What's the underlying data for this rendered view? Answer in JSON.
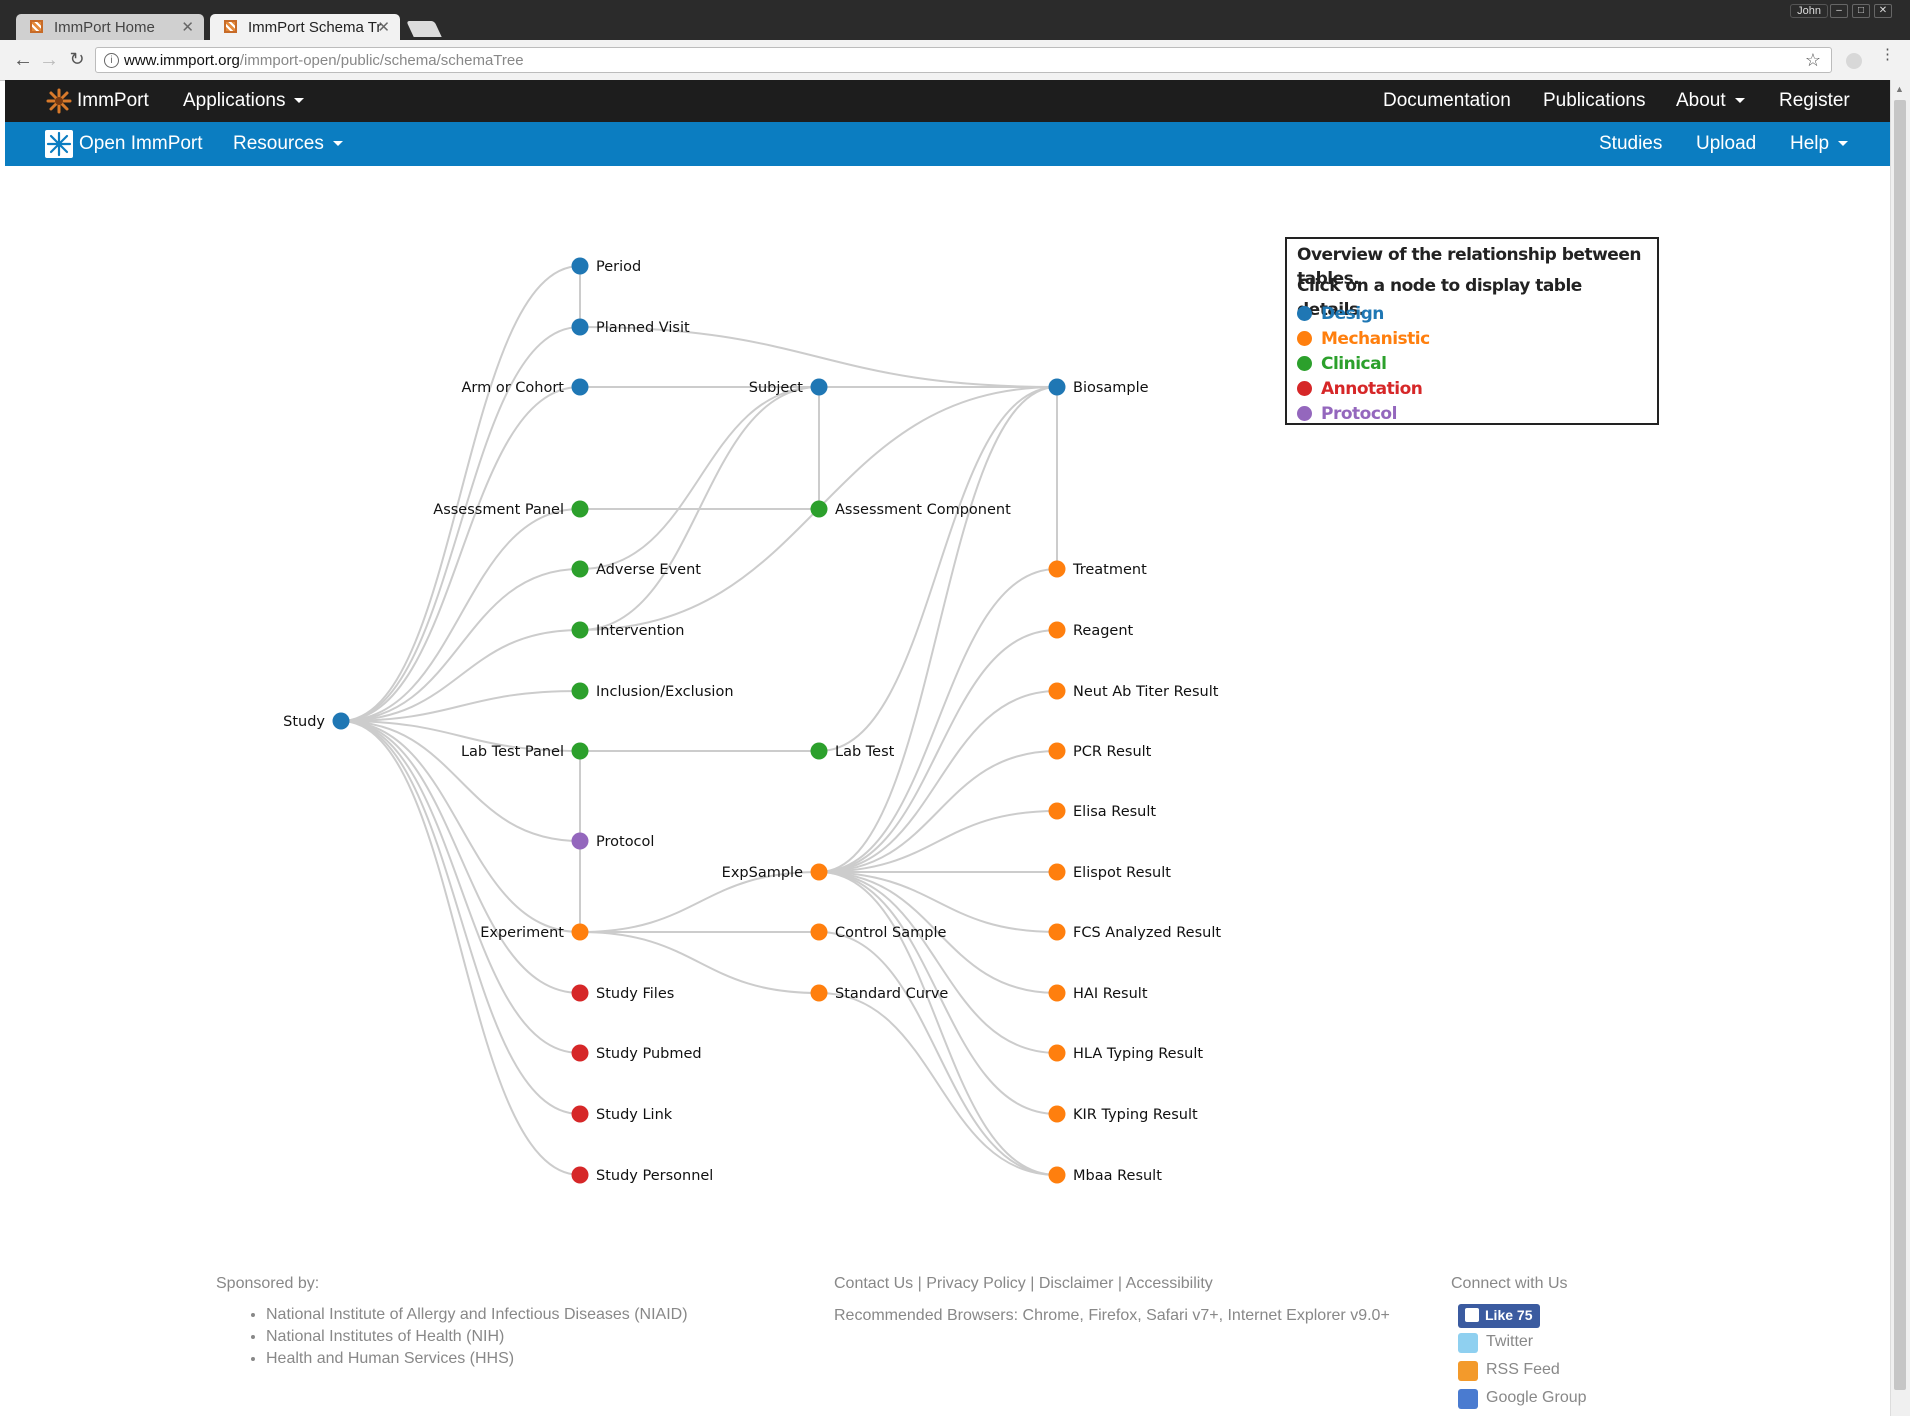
{
  "browser": {
    "tabs": [
      {
        "title": "ImmPort Home",
        "active": false
      },
      {
        "title": "ImmPort Schema Tr",
        "active": true
      }
    ],
    "user_label": "John",
    "url_host": "www.immport.org",
    "url_path": "/immport-open/public/schema/schemaTree"
  },
  "topnav": {
    "brand": "ImmPort",
    "applications": "Applications",
    "right": [
      "Documentation",
      "Publications",
      "About",
      "Register"
    ]
  },
  "subnav": {
    "brand": "Open ImmPort",
    "resources": "Resources",
    "right": [
      "Studies",
      "Upload",
      "Help"
    ]
  },
  "legend": {
    "title1": "Overview of the relationship between tables.",
    "title2": "Click on a node to display table details.",
    "items": [
      {
        "label": "Design",
        "color": "#1f77b4"
      },
      {
        "label": "Mechanistic",
        "color": "#ff7f0e"
      },
      {
        "label": "Clinical",
        "color": "#2ca02c"
      },
      {
        "label": "Annotation",
        "color": "#d62728"
      },
      {
        "label": "Protocol",
        "color": "#9467bd"
      }
    ]
  },
  "graph": {
    "nodes": {
      "study": {
        "label": "Study",
        "category": "Design"
      },
      "period": {
        "label": "Period",
        "category": "Design"
      },
      "planned_visit": {
        "label": "Planned Visit",
        "category": "Design"
      },
      "arm": {
        "label": "Arm or Cohort",
        "category": "Design"
      },
      "assessment_panel": {
        "label": "Assessment Panel",
        "category": "Clinical"
      },
      "adverse_event": {
        "label": "Adverse Event",
        "category": "Clinical"
      },
      "intervention": {
        "label": "Intervention",
        "category": "Clinical"
      },
      "inclusion": {
        "label": "Inclusion/Exclusion",
        "category": "Clinical"
      },
      "lab_test_panel": {
        "label": "Lab Test Panel",
        "category": "Clinical"
      },
      "protocol": {
        "label": "Protocol",
        "category": "Protocol"
      },
      "experiment": {
        "label": "Experiment",
        "category": "Mechanistic"
      },
      "study_files": {
        "label": "Study Files",
        "category": "Annotation"
      },
      "study_pubmed": {
        "label": "Study Pubmed",
        "category": "Annotation"
      },
      "study_link": {
        "label": "Study Link",
        "category": "Annotation"
      },
      "study_personnel": {
        "label": "Study Personnel",
        "category": "Annotation"
      },
      "subject": {
        "label": "Subject",
        "category": "Design"
      },
      "assessment_component": {
        "label": "Assessment Component",
        "category": "Clinical"
      },
      "lab_test": {
        "label": "Lab Test",
        "category": "Clinical"
      },
      "expsample": {
        "label": "ExpSample",
        "category": "Mechanistic"
      },
      "control_sample": {
        "label": "Control Sample",
        "category": "Mechanistic"
      },
      "standard_curve": {
        "label": "Standard Curve",
        "category": "Mechanistic"
      },
      "biosample": {
        "label": "Biosample",
        "category": "Design"
      },
      "treatment": {
        "label": "Treatment",
        "category": "Mechanistic"
      },
      "reagent": {
        "label": "Reagent",
        "category": "Mechanistic"
      },
      "neut": {
        "label": "Neut Ab Titer Result",
        "category": "Mechanistic"
      },
      "pcr": {
        "label": "PCR Result",
        "category": "Mechanistic"
      },
      "elisa": {
        "label": "Elisa Result",
        "category": "Mechanistic"
      },
      "elispot": {
        "label": "Elispot Result",
        "category": "Mechanistic"
      },
      "fcs": {
        "label": "FCS Analyzed Result",
        "category": "Mechanistic"
      },
      "hai": {
        "label": "HAI Result",
        "category": "Mechanistic"
      },
      "hla": {
        "label": "HLA Typing Result",
        "category": "Mechanistic"
      },
      "kir": {
        "label": "KIR Typing Result",
        "category": "Mechanistic"
      },
      "mbaa": {
        "label": "Mbaa Result",
        "category": "Mechanistic"
      }
    },
    "edges": [
      [
        "study",
        "period"
      ],
      [
        "study",
        "planned_visit"
      ],
      [
        "study",
        "arm"
      ],
      [
        "study",
        "assessment_panel"
      ],
      [
        "study",
        "adverse_event"
      ],
      [
        "study",
        "intervention"
      ],
      [
        "study",
        "inclusion"
      ],
      [
        "study",
        "lab_test_panel"
      ],
      [
        "study",
        "protocol"
      ],
      [
        "study",
        "experiment"
      ],
      [
        "study",
        "study_files"
      ],
      [
        "study",
        "study_pubmed"
      ],
      [
        "study",
        "study_link"
      ],
      [
        "study",
        "study_personnel"
      ],
      [
        "period",
        "planned_visit"
      ],
      [
        "planned_visit",
        "biosample"
      ],
      [
        "arm",
        "subject"
      ],
      [
        "subject",
        "biosample"
      ],
      [
        "subject",
        "assessment_component"
      ],
      [
        "assessment_panel",
        "assessment_component"
      ],
      [
        "adverse_event",
        "subject"
      ],
      [
        "intervention",
        "subject"
      ],
      [
        "intervention",
        "biosample"
      ],
      [
        "lab_test_panel",
        "lab_test"
      ],
      [
        "lab_test_panel",
        "protocol"
      ],
      [
        "protocol",
        "experiment"
      ],
      [
        "lab_test",
        "biosample"
      ],
      [
        "experiment",
        "expsample"
      ],
      [
        "experiment",
        "control_sample"
      ],
      [
        "experiment",
        "standard_curve"
      ],
      [
        "expsample",
        "biosample"
      ],
      [
        "biosample",
        "treatment"
      ],
      [
        "expsample",
        "treatment"
      ],
      [
        "expsample",
        "reagent"
      ],
      [
        "expsample",
        "neut"
      ],
      [
        "expsample",
        "pcr"
      ],
      [
        "expsample",
        "elisa"
      ],
      [
        "expsample",
        "elispot"
      ],
      [
        "expsample",
        "fcs"
      ],
      [
        "expsample",
        "hai"
      ],
      [
        "expsample",
        "hla"
      ],
      [
        "expsample",
        "kir"
      ],
      [
        "expsample",
        "mbaa"
      ],
      [
        "control_sample",
        "mbaa"
      ],
      [
        "standard_curve",
        "mbaa"
      ]
    ]
  },
  "footer": {
    "sponsored_by": "Sponsored by:",
    "sponsors": [
      "National Institute of Allergy and Infectious Diseases (NIAID)",
      "National Institutes of Health (NIH)",
      "Health and Human Services (HHS)"
    ],
    "links": [
      "Contact Us",
      "Privacy Policy",
      "Disclaimer",
      "Accessibility"
    ],
    "browsers": "Recommended Browsers: Chrome, Firefox, Safari v7+, Internet Explorer v9.0+",
    "connect": "Connect with Us",
    "fb_like": "Like 75",
    "twitter": "Twitter",
    "rss": "RSS Feed",
    "google": "Google Group"
  }
}
